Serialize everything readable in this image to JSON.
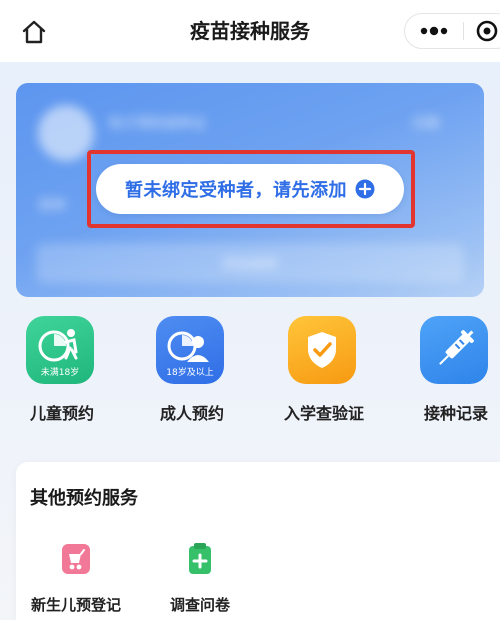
{
  "header": {
    "title": "疫苗接种服务",
    "home_icon": "home-icon",
    "more_icon": "more-dots-icon",
    "close_icon": "target-close-icon"
  },
  "card": {
    "blurred_title": "电子预防接种证",
    "blurred_right": "切换",
    "blurred_left": "受种",
    "blurred_bottom": "添加接种",
    "bind_prompt": "暂未绑定受种者，请先添加",
    "accent_color": "#2f6ee6",
    "highlight_color": "#e2352f"
  },
  "services": [
    {
      "label": "儿童预约",
      "tag": "未满18岁",
      "icon": "child-icon",
      "color": "#1fb67c"
    },
    {
      "label": "成人预约",
      "tag": "18岁及以上",
      "icon": "adult-icon",
      "color": "#2f6ee6"
    },
    {
      "label": "入学查验证",
      "tag": "",
      "icon": "school-check-icon",
      "color": "#f79a12"
    },
    {
      "label": "接种记录",
      "tag": "",
      "icon": "syringe-icon",
      "color": "#2f84ea"
    }
  ],
  "other": {
    "title": "其他预约服务",
    "items": [
      {
        "label": "新生儿预登记",
        "icon": "stroller-icon",
        "color": "#f06a8c"
      },
      {
        "label": "调查问卷",
        "icon": "questionnaire-icon",
        "color": "#37c06a"
      }
    ]
  }
}
